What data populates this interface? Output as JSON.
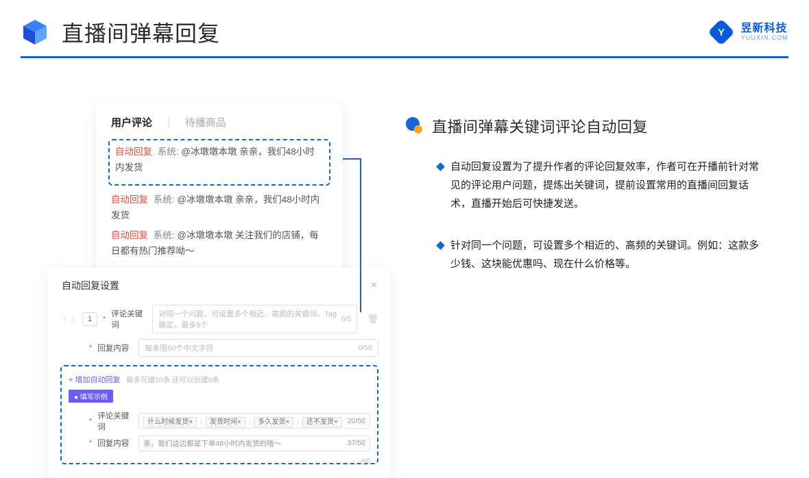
{
  "header": {
    "title": "直播间弹幕回复",
    "brand_cn": "昱新科技",
    "brand_en": "YUUXIN.COM"
  },
  "top_card": {
    "tab_active": "用户评论",
    "tab_inactive": "待播商品",
    "comment_highlight": {
      "tag": "自动回复",
      "sys": "系统:",
      "text": "@冰墩墩本墩 亲亲，我们48小时内发货"
    },
    "comment2": {
      "tag": "自动回复",
      "sys": "系统:",
      "text": "@冰墩墩本墩 亲亲，我们48小时内发货"
    },
    "comment3": {
      "tag": "自动回复",
      "sys": "系统:",
      "text": "@冰墩墩本墩 关注我们的店铺，每日都有热门推荐呦～"
    }
  },
  "settings_card": {
    "title": "自动回复设置",
    "seq": "1",
    "row1_label": "评论关键词",
    "row1_placeholder": "对同一个问题，可设置多个相近、高频的关键词，Tag确定，最多5个",
    "row1_counter": "0/5",
    "row2_label": "回复内容",
    "row2_placeholder": "每条限50个中文字符",
    "row2_counter": "0/50",
    "add_link": "+ 增加自动回复",
    "add_note": "最多可建10条 还可以创建9条",
    "example_badge": "● 填写示例",
    "ex_row1_label": "评论关键词",
    "ex_tags": [
      "什么时候发货×",
      "发货时间×",
      "多久发货×",
      "还不发货×"
    ],
    "ex_row1_counter": "20/50",
    "ex_row2_label": "回复内容",
    "ex_row2_text": "亲，我们这边都是下单48小时内发货的哦～",
    "ex_row2_counter": "37/50",
    "over_counter": "/50"
  },
  "right": {
    "section_title": "直播间弹幕关键词评论自动回复",
    "bullet1": "自动回复设置为了提升作者的评论回复效率，作者可在开播前针对常见的评论用户问题，提炼出关键词，提前设置常用的直播间回复话术，直播开始后可快捷发送。",
    "bullet2": "针对同一个问题，可设置多个相近的、高频的关键词。例如：这款多少钱、这块能优惠吗、现在什么价格等。"
  }
}
